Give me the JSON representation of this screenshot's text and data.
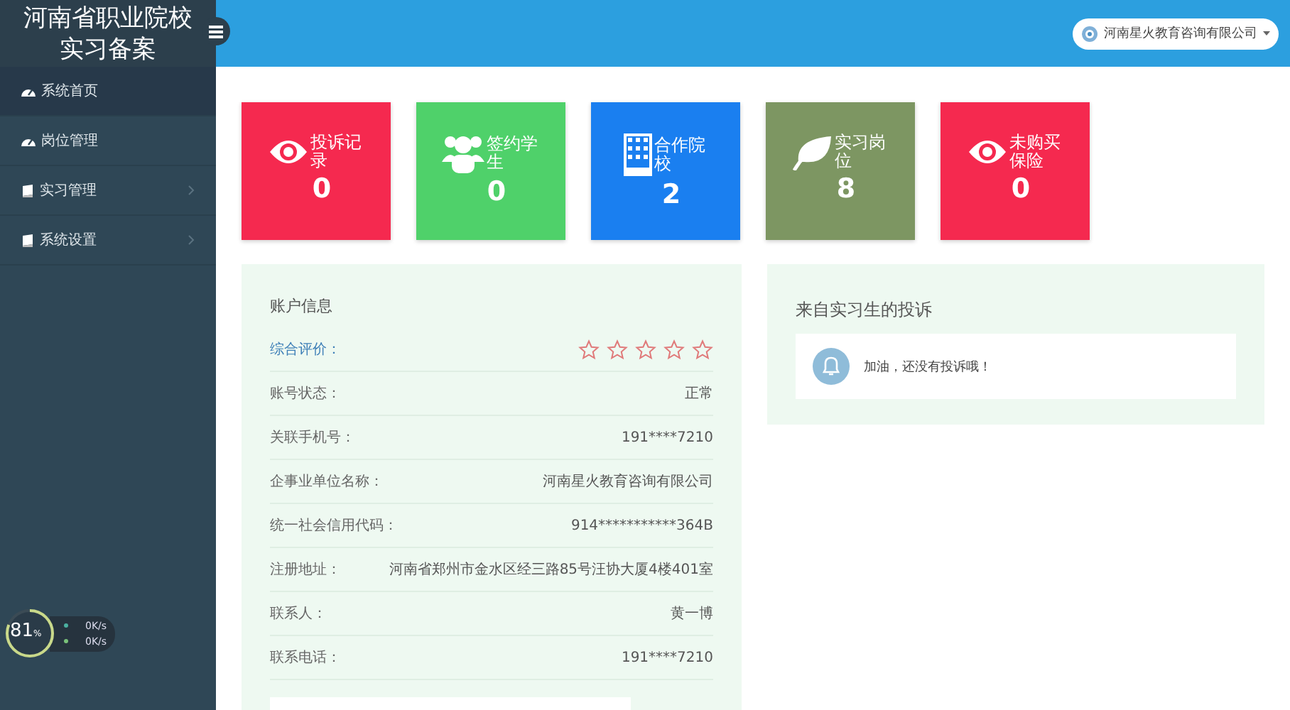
{
  "sidebar": {
    "title": "河南省职业院校实习备案",
    "items": [
      {
        "label": "系统首页",
        "kind": "gauge",
        "selected": true,
        "has_arrow": false
      },
      {
        "label": "岗位管理",
        "kind": "gauge",
        "selected": false,
        "has_arrow": false
      },
      {
        "label": "实习管理",
        "kind": "book",
        "selected": false,
        "has_arrow": true
      },
      {
        "label": "系统设置",
        "kind": "book",
        "selected": false,
        "has_arrow": true
      }
    ]
  },
  "header": {
    "company": "河南星火教育咨询有限公司"
  },
  "stat_cards": [
    {
      "label": "投诉记录",
      "value": "0",
      "kind": "eye",
      "color": "#f5294f"
    },
    {
      "label": "签约学生",
      "value": "0",
      "kind": "users",
      "color": "#4fd16a"
    },
    {
      "label": "合作院校",
      "value": "2",
      "kind": "building",
      "color": "#1a7ff0"
    },
    {
      "label": "实习岗位",
      "value": "8",
      "kind": "leaf",
      "color": "#7d9662"
    },
    {
      "label": "未购买保险",
      "value": "0",
      "kind": "eye",
      "color": "#f5294f"
    }
  ],
  "account": {
    "title": "账户信息",
    "rating": {
      "label": "综合评价：",
      "stars": 0
    },
    "rows": [
      {
        "label": "账号状态：",
        "value": "正常"
      },
      {
        "label": "关联手机号：",
        "value": "191****7210"
      },
      {
        "label": "企事业单位名称：",
        "value": "河南星火教育咨询有限公司"
      },
      {
        "label": "统一社会信用代码：",
        "value": "914***********364B"
      },
      {
        "label": "注册地址：",
        "value": "河南省郑州市金水区经三路85号汪协大厦4楼401室"
      },
      {
        "label": "联系人：",
        "value": "黄一博"
      },
      {
        "label": "联系电话：",
        "value": "191****7210"
      }
    ]
  },
  "complaints": {
    "title": "来自实习生的投诉",
    "message": "加油，还没有投诉哦！"
  },
  "monitor": {
    "percent": "81",
    "unit": "%",
    "level": 0.81,
    "upload": "0K/s",
    "download": "0K/s"
  }
}
